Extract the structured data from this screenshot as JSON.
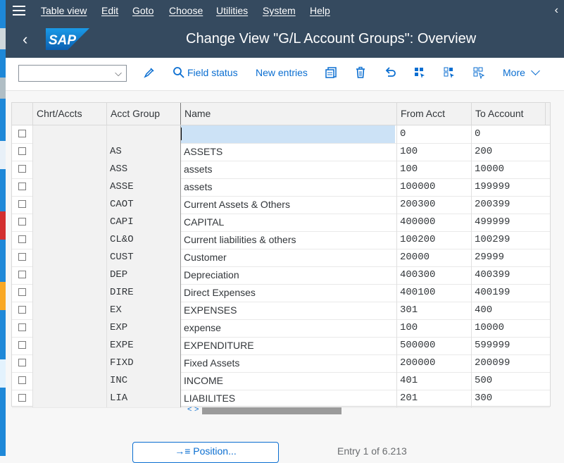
{
  "menu": {
    "items": [
      "Table view",
      "Edit",
      "Goto",
      "Choose",
      "Utilities",
      "System",
      "Help"
    ]
  },
  "title": {
    "text": "Change View \"G/L Account Groups\": Overview",
    "logo_text": "SAP"
  },
  "toolbar": {
    "dropdown_value": "",
    "field_status": "Field status",
    "new_entries": "New entries",
    "more": "More"
  },
  "table": {
    "headers": [
      "Chrt/Accts",
      "Acct Group",
      "Name",
      "From Acct",
      "To Account"
    ],
    "rows": [
      {
        "chart": "",
        "group": "",
        "name": "",
        "from": "0",
        "to": "0"
      },
      {
        "chart": "",
        "group": "AS",
        "name": "ASSETS",
        "from": "100",
        "to": "200"
      },
      {
        "chart": "",
        "group": "ASS",
        "name": "assets",
        "from": "100",
        "to": "10000"
      },
      {
        "chart": "",
        "group": "ASSE",
        "name": "assets",
        "from": "100000",
        "to": "199999"
      },
      {
        "chart": "",
        "group": "CAOT",
        "name": "Current Assets & Others",
        "from": "200300",
        "to": "200399"
      },
      {
        "chart": "",
        "group": "CAPI",
        "name": "CAPITAL",
        "from": "400000",
        "to": "499999"
      },
      {
        "chart": "",
        "group": "CL&O",
        "name": "Current liabilities & others",
        "from": "100200",
        "to": "100299"
      },
      {
        "chart": "",
        "group": "CUST",
        "name": "Customer",
        "from": "20000",
        "to": "29999"
      },
      {
        "chart": "",
        "group": "DEP",
        "name": "Depreciation",
        "from": "400300",
        "to": "400399"
      },
      {
        "chart": "",
        "group": "DIRE",
        "name": "Direct Expenses",
        "from": "400100",
        "to": "400199"
      },
      {
        "chart": "",
        "group": "EX",
        "name": "EXPENSES",
        "from": "301",
        "to": "400"
      },
      {
        "chart": "",
        "group": "EXP",
        "name": "expense",
        "from": "100",
        "to": "10000"
      },
      {
        "chart": "",
        "group": "EXPE",
        "name": "EXPENDITURE",
        "from": "500000",
        "to": "599999"
      },
      {
        "chart": "",
        "group": "FIXD",
        "name": "Fixed Assets",
        "from": "200000",
        "to": "200099"
      },
      {
        "chart": "",
        "group": "INC",
        "name": "INCOME",
        "from": "401",
        "to": "500"
      },
      {
        "chart": "",
        "group": "LIA",
        "name": "LIABILITES",
        "from": "201",
        "to": "300"
      }
    ]
  },
  "footer": {
    "position_button": "Position...",
    "position_icon": "→≡",
    "entry_text": "Entry 1 of 6.213"
  },
  "colors": {
    "shell": "#354a5f",
    "accent": "#0a6ed1",
    "focus_cell": "#cce2f6"
  }
}
